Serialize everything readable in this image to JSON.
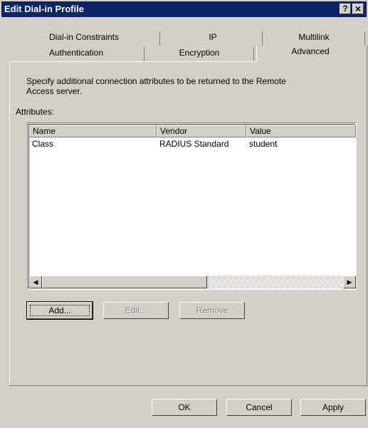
{
  "window": {
    "title": "Edit Dial-in Profile",
    "help_btn": "?",
    "close_btn": "×"
  },
  "tabs": {
    "row1": [
      "Dial-in Constraints",
      "IP",
      "Multilink"
    ],
    "row2": [
      "Authentication",
      "Encryption",
      "Advanced"
    ],
    "selected": "Advanced"
  },
  "advanced": {
    "description_line1": "Specify additional connection attributes to be returned to the Remote",
    "description_line2": "Access server.",
    "attributes_label": "Attributes:",
    "columns": [
      "Name",
      "Vendor",
      "Value"
    ],
    "rows": [
      {
        "name": "Class",
        "vendor": "RADIUS Standard",
        "value": "student"
      }
    ],
    "buttons": {
      "add": "Add...",
      "edit": "Edit...",
      "remove": "Remove"
    }
  },
  "footer": {
    "ok": "OK",
    "cancel": "Cancel",
    "apply": "Apply"
  }
}
